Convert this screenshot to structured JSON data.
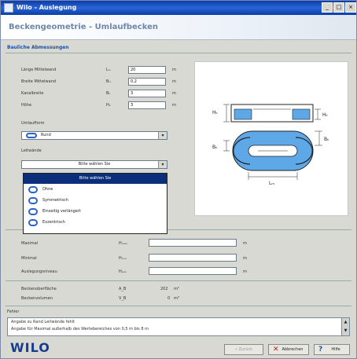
{
  "window": {
    "title": "Wilo - Auslegung",
    "controls": [
      "_",
      "□",
      "×"
    ]
  },
  "heading": "Beckengeometrie - Umlaufbecken",
  "section_dims": "Bauliche Abmessungen",
  "fields": [
    {
      "label": "Länge Mittelwand",
      "symbol": "Lₘ",
      "value": "20",
      "unit": "m"
    },
    {
      "label": "Breite Mittelwand",
      "symbol": "Bₘ",
      "value": "0,2",
      "unit": "m"
    },
    {
      "label": "Kanalbreite",
      "symbol": "Bₖ",
      "value": "3",
      "unit": "m"
    },
    {
      "label": "Höhe",
      "symbol": "Hₖ",
      "value": "3",
      "unit": "m"
    }
  ],
  "umlaufform": {
    "label": "Umlaufform",
    "value": "Rund"
  },
  "leitwaende": {
    "label": "Leitwände",
    "value": "Bitte wählen Sie"
  },
  "dropdown": {
    "selected": "Bitte wählen Sie",
    "items": [
      "Ohne",
      "Symmetrisch",
      "Einseitig verlängert",
      "Exzentrisch"
    ]
  },
  "levels": [
    {
      "label": "Maximal",
      "symbol": "Hₘₐₓ",
      "value": "",
      "unit": "m"
    },
    {
      "label": "Minimal",
      "symbol": "Hₘᵢₙ",
      "value": "",
      "unit": "m"
    },
    {
      "label": "Auslegungsniveau",
      "symbol": "Hₐᵤₛ",
      "value": "",
      "unit": "m"
    }
  ],
  "results": [
    {
      "label": "Beckenoberfläche",
      "symbol": "A_B",
      "value": "202",
      "unit": "m²"
    },
    {
      "label": "Beckenvolumen",
      "symbol": "V_B",
      "value": "0",
      "unit": "m³"
    }
  ],
  "info": {
    "label": "Fehler",
    "lines": [
      "Angabe zu Rand Leitwände fehlt",
      "Angabe für Maximal außerhalb des Wertebereiches von 0,5 m bis 8 m"
    ]
  },
  "diagram_labels": {
    "h_left": "Hₖ",
    "h_right": "Hₖ",
    "b_left": "Bₖ",
    "b_right": "Bₖ",
    "l": "Lₘ"
  },
  "logo": "WILO",
  "buttons": {
    "back": "« Zurück",
    "cancel": "Abbrechen",
    "help": "Hilfe"
  },
  "colors": {
    "accent": "#1f4f9f",
    "selection": "#0a2e7a",
    "water": "#5fa8e8"
  }
}
